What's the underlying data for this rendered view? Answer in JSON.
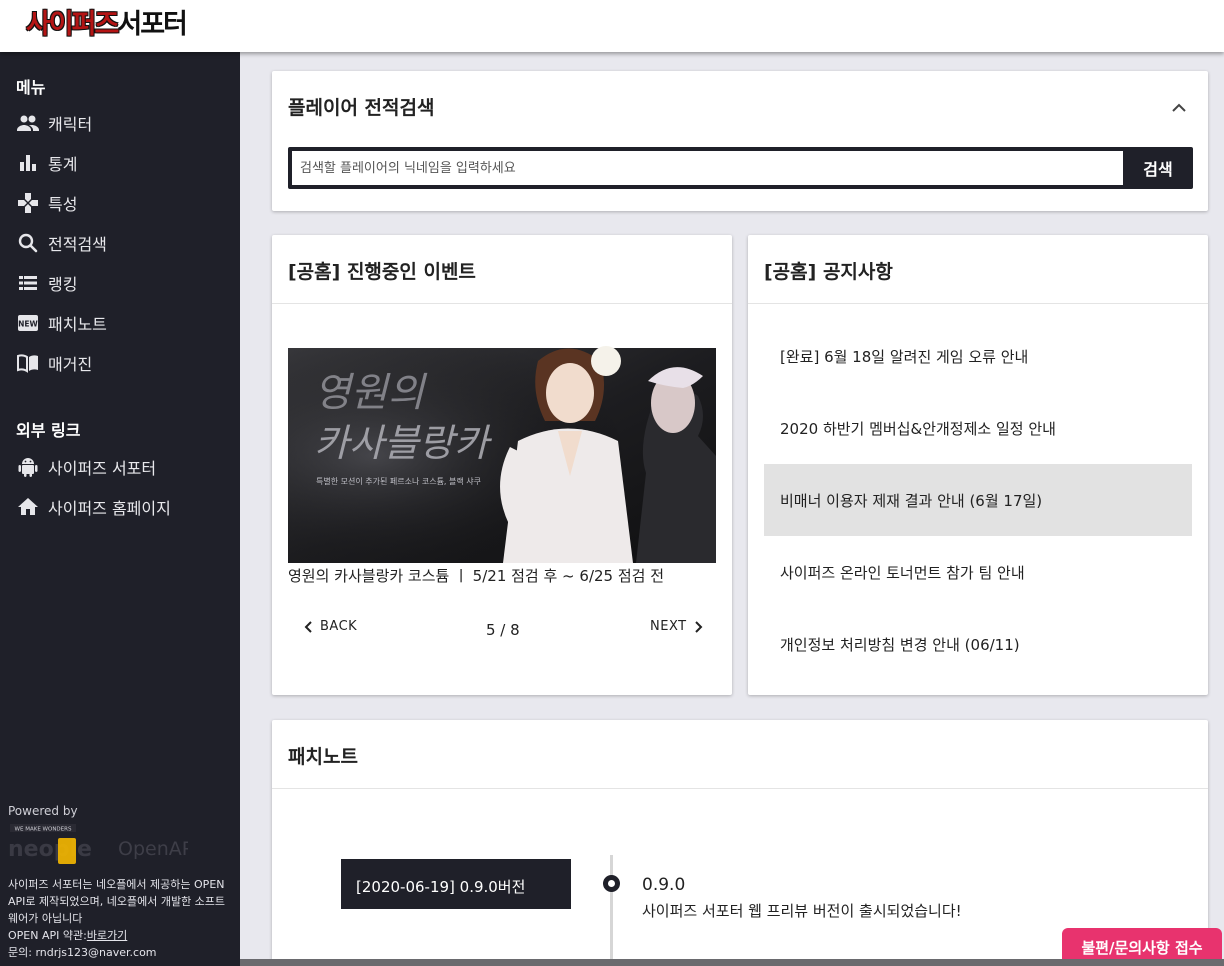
{
  "header": {
    "logo_part1": "사이퍼즈",
    "logo_part2": "서포터"
  },
  "sidebar": {
    "menu_title": "메뉴",
    "items": [
      {
        "label": "캐릭터",
        "icon": "people-icon"
      },
      {
        "label": "통계",
        "icon": "bar-chart-icon"
      },
      {
        "label": "특성",
        "icon": "gamepad-icon"
      },
      {
        "label": "전적검색",
        "icon": "search-icon"
      },
      {
        "label": "랭킹",
        "icon": "list-icon"
      },
      {
        "label": "패치노트",
        "icon": "new-badge-icon"
      },
      {
        "label": "매거진",
        "icon": "book-icon"
      }
    ],
    "external_title": "외부 링크",
    "external_items": [
      {
        "label": "사이퍼즈 서포터",
        "icon": "android-icon"
      },
      {
        "label": "사이퍼즈 홈페이지",
        "icon": "home-icon"
      }
    ],
    "powered_by": "Powered by",
    "neople_tagline": "WE MAKE WONDERS",
    "neople_name": "neople",
    "neople_openapi": "OpenAPI",
    "footer_line1": "사이퍼즈 서포터는 네오플에서 제공하는 OPEN API로 제작되었으며, 네오플에서 개발한 소프트웨어가 아닙니다",
    "footer_terms_prefix": "OPEN API 약관:",
    "footer_terms_link": "바로가기",
    "footer_contact": "문의: rndrjs123@naver.com"
  },
  "search_card": {
    "title": "플레이어 전적검색",
    "placeholder": "검색할 플레이어의 닉네임을 입력하세요",
    "button": "검색"
  },
  "event_card": {
    "title": "[공홈] 진행중인 이벤트",
    "banner_title_line1": "영원의",
    "banner_title_line2": "카사블랑카",
    "banner_subtitle": "특별한 모션이 추가된 페르소나 코스튬, 블랙 샤쿠",
    "caption": "영원의 카사블랑카 코스튬 ㅣ 5/21 점검 후 ~ 6/25 점검 전",
    "back_label": "BACK",
    "next_label": "NEXT",
    "page_indicator": "5 / 8"
  },
  "notice_card": {
    "title": "[공홈] 공지사항",
    "items": [
      "[완료] 6월 18일 알려진 게임 오류 안내",
      "2020 하반기 멤버십&안개정제소 일정 안내",
      "비매너 이용자 제재 결과 안내 (6월 17일)",
      "사이퍼즈 온라인 토너먼트 참가 팀 안내",
      "개인정보 처리방침 변경 안내 (06/11)"
    ]
  },
  "patch_card": {
    "title": "패치노트",
    "entry_tag": "[2020-06-19] 0.9.0버전",
    "entry_version": "0.9.0",
    "entry_desc": "사이퍼즈 서포터 웹 프리뷰 버전이 출시되었습니다!"
  },
  "feedback_button": "불편/문의사항 접수",
  "colors": {
    "sidebar_bg": "#1f2029",
    "page_bg": "#e8e8ee",
    "accent_pink": "#e8336e",
    "logo_red": "#b41414",
    "highlight_row": "#e2e2e2"
  }
}
